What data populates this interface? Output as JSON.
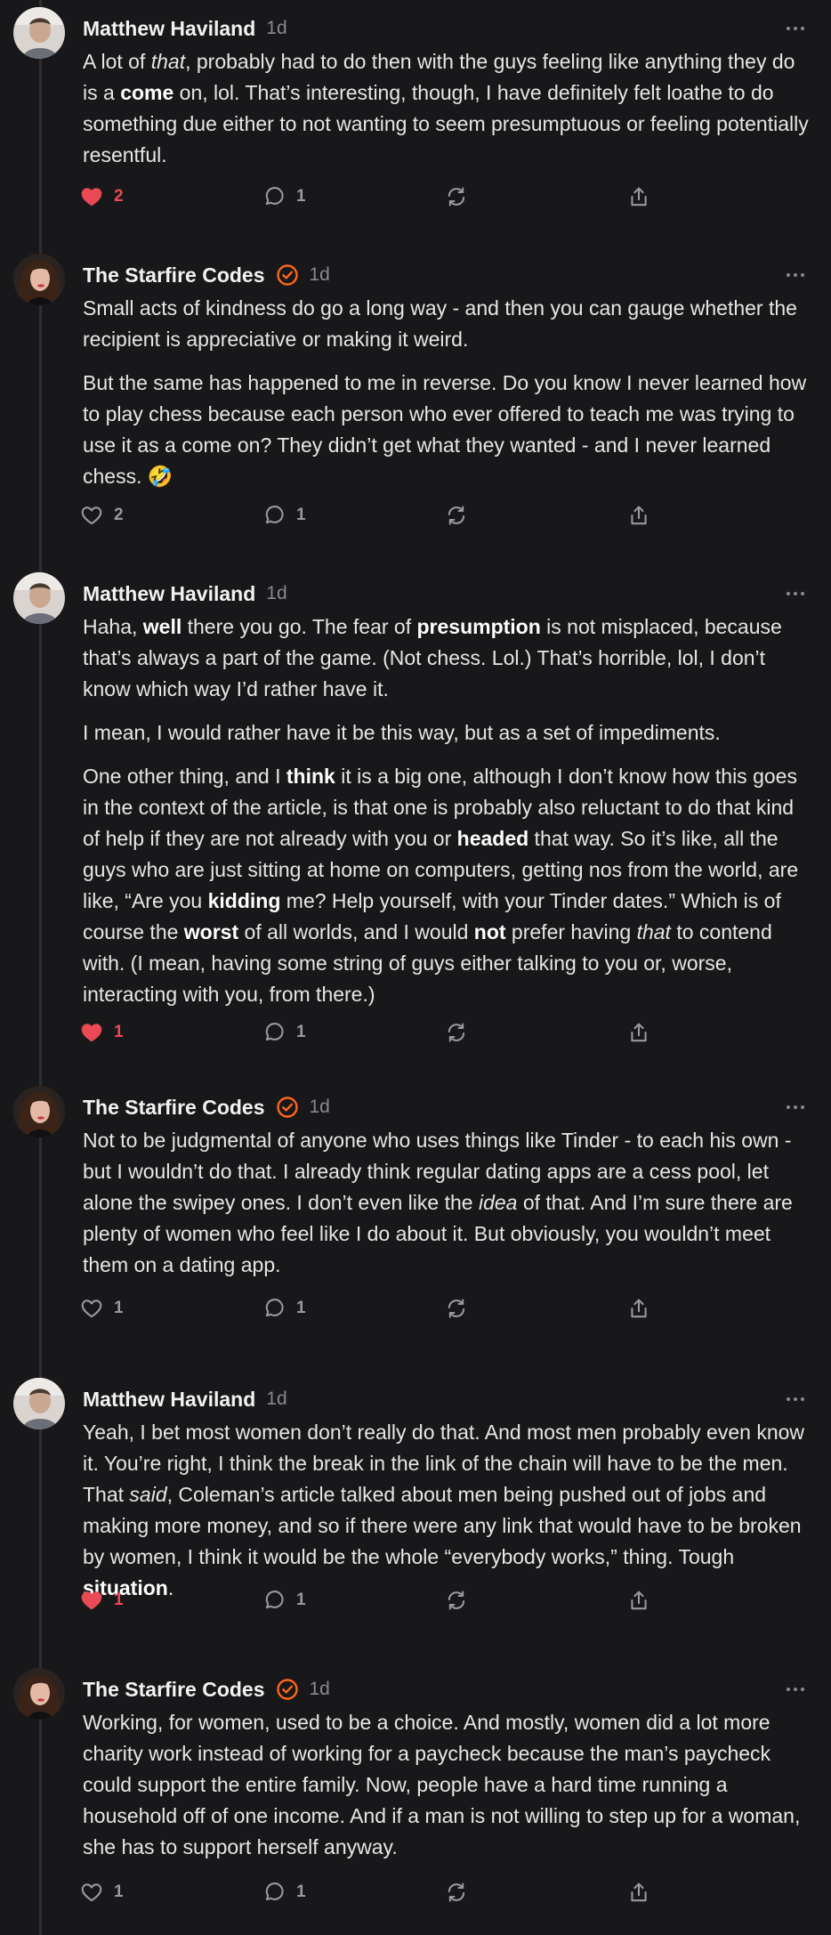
{
  "colors": {
    "background": "#18181a",
    "accent": "#ff6719",
    "like_active": "#ea4a55",
    "muted": "#8a8a8e"
  },
  "icons": {
    "like": "heart-icon",
    "reply": "speech-bubble-icon",
    "restack": "restack-arrows-icon",
    "share": "share-icon",
    "more": "ellipsis-icon",
    "verified": "checkmark-circle-icon"
  },
  "comments": [
    {
      "author": "Matthew Haviland",
      "time": "1d",
      "verified": false,
      "paragraphs": [
        [
          {
            "t": "A lot of "
          },
          {
            "t": "that",
            "i": true
          },
          {
            "t": ", probably had to do then with the guys feeling like anything they do is a "
          },
          {
            "t": "come",
            "b": true
          },
          {
            "t": " on, lol. That’s interesting, though, I have definitely felt loathe to do something due either to not wanting to seem presumptuous or feeling potentially resentful."
          }
        ]
      ],
      "likes": "2",
      "liked": true,
      "replies": "1"
    },
    {
      "author": "The Starfire Codes",
      "time": "1d",
      "verified": true,
      "paragraphs": [
        [
          {
            "t": "Small acts of kindness do go a long way - and then you can gauge whether the recipient is appreciative or making it weird."
          }
        ],
        [
          {
            "t": "But the same has happened to me in reverse. Do you know I never learned how to play chess because each person who ever offered to teach me was trying to use it as a come on? They didn’t get what they wanted - and I never learned chess. 🤣"
          }
        ]
      ],
      "likes": "2",
      "liked": false,
      "replies": "1"
    },
    {
      "author": "Matthew Haviland",
      "time": "1d",
      "verified": false,
      "paragraphs": [
        [
          {
            "t": "Haha, "
          },
          {
            "t": "well",
            "b": true
          },
          {
            "t": " there you go. The fear of "
          },
          {
            "t": "presumption",
            "b": true
          },
          {
            "t": " is not misplaced, because that’s always a part of the game. (Not chess. Lol.) That’s horrible, lol, I don’t know which way I’d rather have it."
          }
        ],
        [
          {
            "t": "I mean, I would rather have it be this way, but as a set of impediments."
          }
        ],
        [
          {
            "t": "One other thing, and I "
          },
          {
            "t": "think",
            "b": true
          },
          {
            "t": " it is a big one, although I don’t know how this goes in the context of the article, is that one is probably also reluctant to do that kind of help if they are not already with you or "
          },
          {
            "t": "headed",
            "b": true
          },
          {
            "t": " that way. So it’s like, all the guys who are just sitting at home on computers, getting nos from the world, are like, “Are you "
          },
          {
            "t": "kidding",
            "b": true
          },
          {
            "t": " me? Help yourself, with your Tinder dates.” Which is of course the "
          },
          {
            "t": "worst",
            "b": true
          },
          {
            "t": " of all worlds, and I would "
          },
          {
            "t": "not",
            "b": true
          },
          {
            "t": " prefer having "
          },
          {
            "t": "that",
            "i": true
          },
          {
            "t": " to contend with. (I mean, having some string of guys either talking to you or, worse, interacting with you, from there.)"
          }
        ]
      ],
      "likes": "1",
      "liked": true,
      "replies": "1"
    },
    {
      "author": "The Starfire Codes",
      "time": "1d",
      "verified": true,
      "paragraphs": [
        [
          {
            "t": "Not to be judgmental of anyone who uses things like Tinder - to each his own - but I wouldn’t do that. I already think regular dating apps are a cess pool, let alone the swipey ones. I don’t even like the "
          },
          {
            "t": "idea",
            "i": true
          },
          {
            "t": " of that. And I’m sure there are plenty of women who feel like I do about it. But obviously, you wouldn’t meet them on a dating app."
          }
        ]
      ],
      "likes": "1",
      "liked": false,
      "replies": "1"
    },
    {
      "author": "Matthew Haviland",
      "time": "1d",
      "verified": false,
      "paragraphs": [
        [
          {
            "t": "Yeah, I bet most women don’t really do that. And most men probably even know it. You’re right, I think the break in the link of the chain will have to be the men. That "
          },
          {
            "t": "said",
            "i": true
          },
          {
            "t": ", Coleman’s article talked about men being pushed out of jobs and making more money, and so if there were any link that would have to be broken by women, I think it would be the whole “everybody works,” thing. Tough "
          },
          {
            "t": "situation",
            "b": true
          },
          {
            "t": "."
          }
        ]
      ],
      "likes": "1",
      "liked": true,
      "replies": "1"
    },
    {
      "author": "The Starfire Codes",
      "time": "1d",
      "verified": true,
      "paragraphs": [
        [
          {
            "t": "Working, for women, used to be a choice. And mostly, women did a lot more charity work instead of working for a paycheck because the man’s paycheck could support the entire family. Now, people have a hard time running a household off of one income. And if a man is not willing to step up for a woman, she has to support herself anyway."
          }
        ]
      ],
      "likes": "1",
      "liked": false,
      "replies": "1"
    }
  ]
}
